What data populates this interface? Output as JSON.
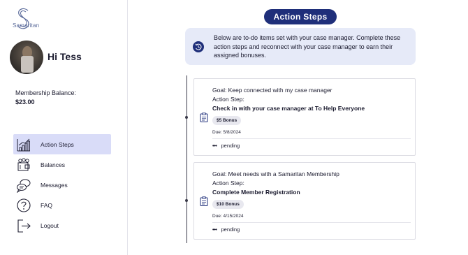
{
  "brand": {
    "logo_text": "Samaritan",
    "accent": "#1f2f7a",
    "active_nav_bg": "#d9dcf8"
  },
  "profile": {
    "greeting": "Hi Tess"
  },
  "balance": {
    "label": "Membership Balance:",
    "value": "$23.00"
  },
  "sidebar": {
    "items": [
      {
        "label": "Action Steps",
        "icon": "chart-bars-icon",
        "active": true
      },
      {
        "label": "Balances",
        "icon": "wallet-icon",
        "active": false
      },
      {
        "label": "Messages",
        "icon": "chat-bubbles-icon",
        "active": false
      },
      {
        "label": "FAQ",
        "icon": "question-icon",
        "active": false
      },
      {
        "label": "Logout",
        "icon": "logout-icon",
        "active": false
      }
    ]
  },
  "main": {
    "title": "Action Steps",
    "info": "Below are to-do items set with your case manager. Complete these action steps and reconnect with your case manager to earn their assigned bonuses.",
    "cards": [
      {
        "goal": "Goal: Keep connected with my case manager",
        "step_label": "Action Step:",
        "step": "Check in with your case manager at To Help Everyone",
        "bonus": "$5 Bonus",
        "due": "Due: 5/8/2024",
        "status": "pending"
      },
      {
        "goal": "Goal: Meet needs with a Samaritan Membership",
        "step_label": "Action Step:",
        "step": "Complete Member Registration",
        "bonus": "$10 Bonus",
        "due": "Due: 4/15/2024",
        "status": "pending"
      }
    ]
  }
}
